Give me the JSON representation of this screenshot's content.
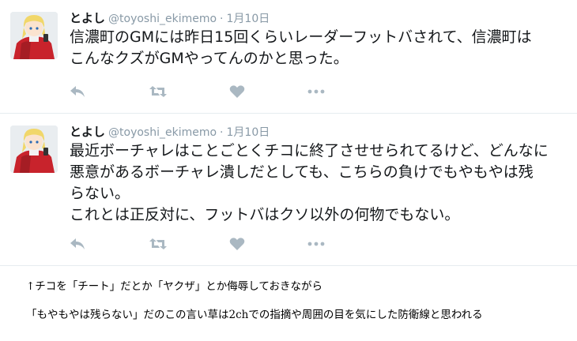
{
  "tweets": [
    {
      "display_name": "とよし",
      "handle": "@toyoshi_ekimemo",
      "separator": "·",
      "date": "1月10日",
      "lines": [
        "信濃町のGMには昨日15回くらいレーダーフットバされて、信濃町は",
        "こんなクズがGMやってんのかと思った。"
      ]
    },
    {
      "display_name": "とよし",
      "handle": "@toyoshi_ekimemo",
      "separator": "·",
      "date": "1月10日",
      "lines": [
        "最近ボーチャレはことごとくチコに終了させせられてるけど、どんなに",
        "悪意があるボーチャレ潰しだとしても、こちらの負けでもやもやは残",
        "らない。",
        "これとは正反対に、フットバはクソ以外の何物でもない。"
      ]
    }
  ],
  "icons": {
    "reply": "reply-icon",
    "retweet": "retweet-icon",
    "like": "heart-icon",
    "more": "more-dots-icon"
  },
  "colors": {
    "action_icon": "#aab8c2",
    "meta_text": "#8899a6",
    "divider": "#e6ecf0"
  },
  "captions": {
    "line1": "↑チコを「チート」だとか「ヤクザ」とか侮辱しておきながら",
    "line2": "「もやもやは残らない」だのこの言い草は2chでの指摘や周囲の目を気にした防衛線と思われる"
  }
}
